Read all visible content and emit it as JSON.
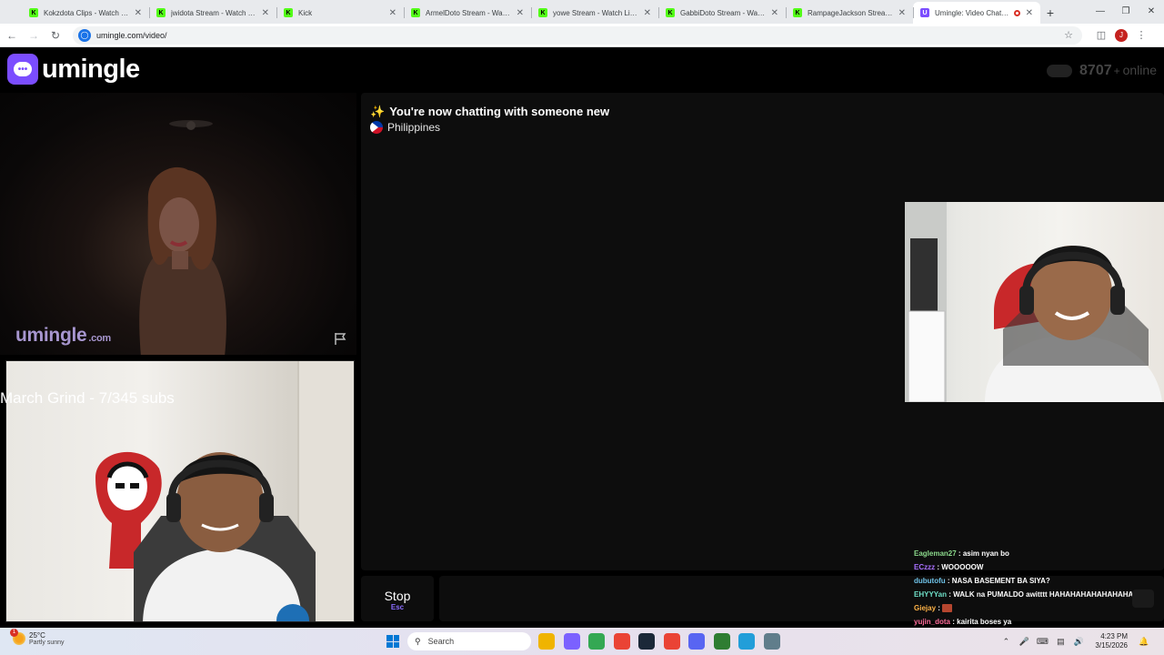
{
  "browser": {
    "tabs": [
      {
        "label": "Kokzdota Clips - Watch Live",
        "favicon": "K",
        "active": false
      },
      {
        "label": "jwidota Stream - Watch Live",
        "favicon": "K",
        "active": false
      },
      {
        "label": "Kick",
        "favicon": "K",
        "active": false
      },
      {
        "label": "ArmelDoto Stream - Watch L",
        "favicon": "K",
        "active": false
      },
      {
        "label": "yowe Stream - Watch Live o",
        "favicon": "K",
        "active": false
      },
      {
        "label": "GabbiDoto Stream - Watch L",
        "favicon": "K",
        "active": false
      },
      {
        "label": "RampageJackson Stream - W",
        "favicon": "K",
        "active": false
      },
      {
        "label": "Umingle: Video Chat with",
        "favicon": "U",
        "active": true
      }
    ],
    "new_tab": "+",
    "url": "umingle.com/video/",
    "profile_initial": "J"
  },
  "site": {
    "brand": "umingle",
    "online_count": "8707",
    "online_plus": "+",
    "online_label": "online"
  },
  "stranger": {
    "watermark": "umingle",
    "watermark_suffix": ".com"
  },
  "stream": {
    "overlay_text": "March Grind - 7/345 subs"
  },
  "chat": {
    "status": "You're now chatting with someone new",
    "country": "Philippines"
  },
  "controls": {
    "stop_label": "Stop",
    "stop_hint": "Esc"
  },
  "twitch_chat": [
    {
      "user": "Eagleman27",
      "color": "#8bd88b",
      "message": "asim nyan bo"
    },
    {
      "user": "ECzzz",
      "color": "#a970ff",
      "message": "WOOOOOW"
    },
    {
      "user": "dubutofu",
      "color": "#6fc3e8",
      "message": "NASA BASEMENT BA SIYA?"
    },
    {
      "user": "EHYYYan",
      "color": "#6fe0c8",
      "message": "WALK na PUMALDO awitttt HAHAHAHAHAHAHAHAHA"
    },
    {
      "user": "Giejay",
      "color": "#ffb347",
      "message": ""
    },
    {
      "user": "yujin_dota",
      "color": "#ff6b9a",
      "message": "kairita boses ya"
    }
  ],
  "taskbar": {
    "weather_temp": "25°C",
    "weather_desc": "Partly sunny",
    "weather_badge": "1",
    "search_placeholder": "Search",
    "time": "4:23 PM",
    "date": "3/15/2026",
    "apps": [
      {
        "name": "file-explorer-icon",
        "color": "#f0b400"
      },
      {
        "name": "copilot-icon",
        "color": "#7b61ff"
      },
      {
        "name": "chrome-icon",
        "color": "#34a853"
      },
      {
        "name": "chrome-icon",
        "color": "#ea4335"
      },
      {
        "name": "steam-icon",
        "color": "#1b2838"
      },
      {
        "name": "chrome-icon",
        "color": "#ea4335"
      },
      {
        "name": "discord-icon",
        "color": "#5865f2"
      },
      {
        "name": "app-icon",
        "color": "#2e7d32"
      },
      {
        "name": "telegram-icon",
        "color": "#229ed9"
      },
      {
        "name": "tool-icon",
        "color": "#607d8b"
      }
    ]
  }
}
